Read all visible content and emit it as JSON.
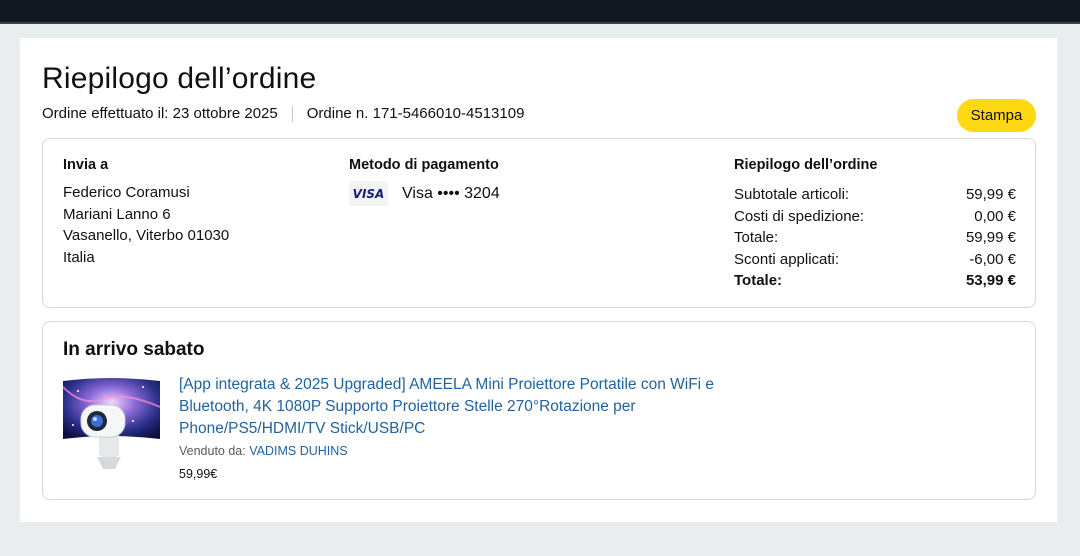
{
  "header": {
    "title": "Riepilogo dell’ordine",
    "order_date_text": "Ordine effettuato il: 23 ottobre 2025",
    "order_number_text": "Ordine n. 171-5466010-4513109",
    "print_label": "Stampa"
  },
  "shipping": {
    "heading": "Invia a",
    "lines": [
      "Federico Coramusi",
      "Mariani Lanno 6",
      "Vasanello, Viterbo 01030",
      "Italia"
    ]
  },
  "payment": {
    "heading": "Metodo di pagamento",
    "card_logo": "VISA",
    "card_text": "Visa •••• 3204"
  },
  "summary": {
    "heading": "Riepilogo dell’ordine",
    "rows": [
      {
        "label": "Subtotale articoli:",
        "value": "59,99 €"
      },
      {
        "label": "Costi di spedizione:",
        "value": "0,00 €"
      },
      {
        "label": "Totale:",
        "value": "59,99 €"
      },
      {
        "label": "Sconti applicati:",
        "value": "-6,00 €"
      }
    ],
    "grand_total": {
      "label": "Totale:",
      "value": "53,99 €"
    }
  },
  "delivery": {
    "heading": "In arrivo sabato",
    "product": {
      "title": "[App integrata & 2025 Upgraded] AMEELA Mini Proiettore Portatile con WiFi e Bluetooth, 4K 1080P Supporto Proiettore Stelle 270°Rotazione per Phone/PS5/HDMI/TV Stick/USB/PC",
      "sold_by_label": "Venduto da:",
      "seller": "VADIMS DUHINS",
      "price": "59,99€"
    }
  },
  "colors": {
    "accent_button": "#ffd814",
    "link": "#2162a1",
    "topbar": "#131921"
  }
}
